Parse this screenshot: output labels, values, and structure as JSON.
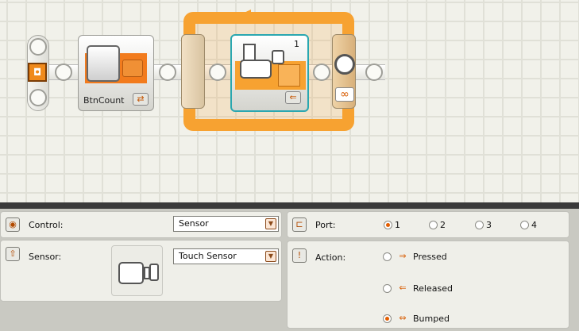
{
  "canvas": {
    "var_block_label": "BtnCount",
    "wait_block_index": "1",
    "loop_infinity": "∞",
    "var_glyph": "⇄",
    "wait_glyph": "⇐"
  },
  "config": {
    "control": {
      "label": "Control:",
      "value": "Sensor"
    },
    "sensor": {
      "label": "Sensor:",
      "value": "Touch Sensor"
    },
    "port": {
      "label": "Port:",
      "options": [
        "1",
        "2",
        "3",
        "4"
      ],
      "selected": "1"
    },
    "action": {
      "label": "Action:",
      "options": [
        "Pressed",
        "Released",
        "Bumped"
      ],
      "selected": "Bumped"
    },
    "caret": "▼"
  },
  "colors": {
    "accent": "#f7a231",
    "selected_radio": "#e35d00",
    "teal_highlight": "#2aa7b0"
  }
}
